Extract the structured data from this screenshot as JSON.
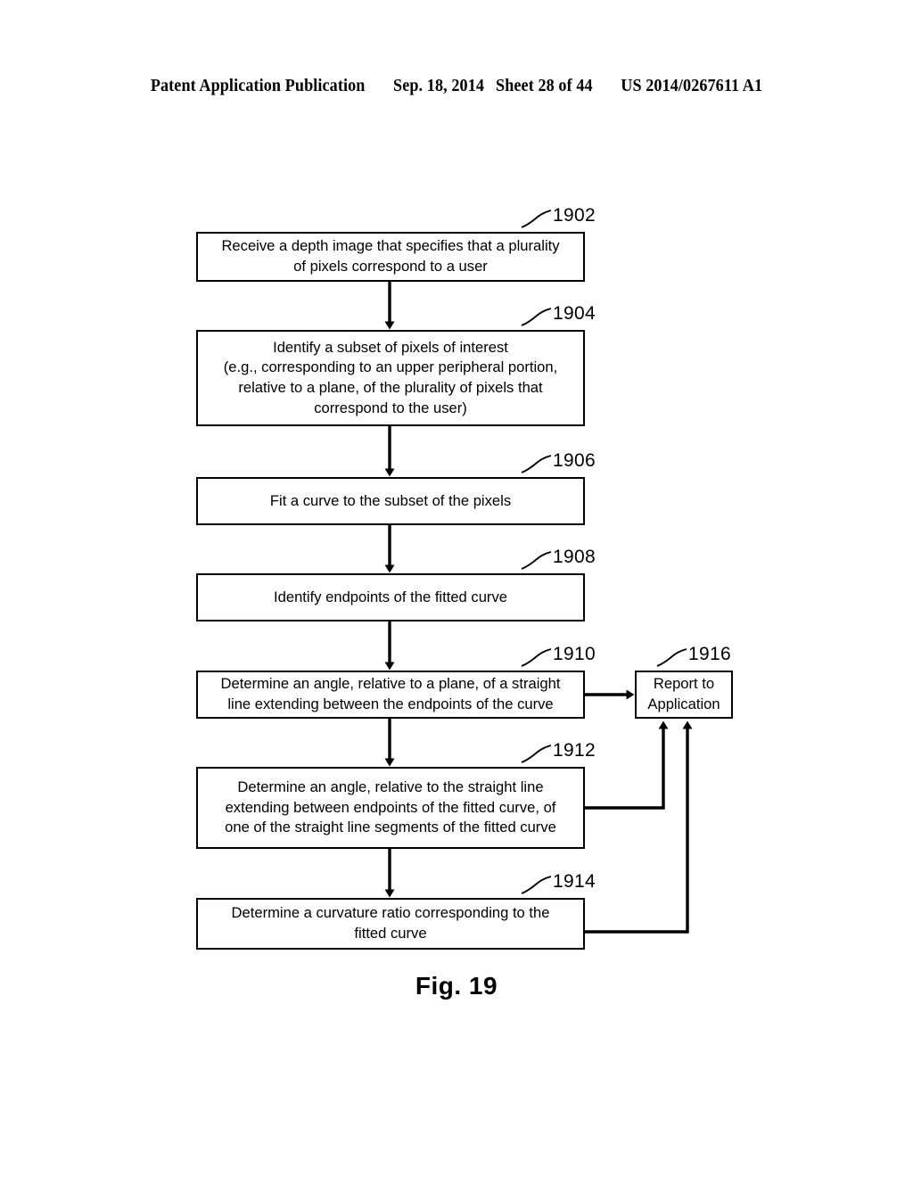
{
  "header": {
    "publication": "Patent Application Publication",
    "date": "Sep. 18, 2014",
    "sheet": "Sheet 28 of 44",
    "patent_number": "US 2014/0267611 A1"
  },
  "figure": {
    "caption": "Fig. 19"
  },
  "flowchart": {
    "boxes": [
      {
        "ref": "1902",
        "text": "Receive a depth image that specifies that a plurality\nof pixels correspond to a user"
      },
      {
        "ref": "1904",
        "text": "Identify a subset of pixels of interest\n(e.g., corresponding to an upper peripheral portion,\nrelative to a plane, of the plurality of pixels that\ncorrespond to the user)"
      },
      {
        "ref": "1906",
        "text": "Fit a curve to the subset of the pixels"
      },
      {
        "ref": "1908",
        "text": "Identify endpoints of the fitted curve"
      },
      {
        "ref": "1910",
        "text": "Determine an angle, relative to a plane, of a straight\nline extending between the endpoints of the curve"
      },
      {
        "ref": "1912",
        "text": "Determine an angle, relative to the straight line\nextending between endpoints of the fitted curve, of\none of the straight line segments of the fitted curve"
      },
      {
        "ref": "1914",
        "text": "Determine a curvature ratio corresponding to the\nfitted curve"
      },
      {
        "ref": "1916",
        "text": "Report to\nApplication"
      }
    ],
    "colors": {
      "stroke": "#000000",
      "background": "#ffffff"
    }
  }
}
